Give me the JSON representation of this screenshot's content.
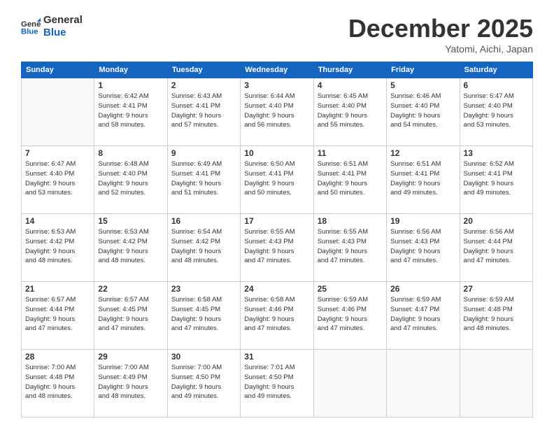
{
  "header": {
    "logo_general": "General",
    "logo_blue": "Blue",
    "month_title": "December 2025",
    "subtitle": "Yatomi, Aichi, Japan"
  },
  "weekdays": [
    "Sunday",
    "Monday",
    "Tuesday",
    "Wednesday",
    "Thursday",
    "Friday",
    "Saturday"
  ],
  "weeks": [
    [
      {
        "day": "",
        "info": ""
      },
      {
        "day": "1",
        "info": "Sunrise: 6:42 AM\nSunset: 4:41 PM\nDaylight: 9 hours\nand 58 minutes."
      },
      {
        "day": "2",
        "info": "Sunrise: 6:43 AM\nSunset: 4:41 PM\nDaylight: 9 hours\nand 57 minutes."
      },
      {
        "day": "3",
        "info": "Sunrise: 6:44 AM\nSunset: 4:40 PM\nDaylight: 9 hours\nand 56 minutes."
      },
      {
        "day": "4",
        "info": "Sunrise: 6:45 AM\nSunset: 4:40 PM\nDaylight: 9 hours\nand 55 minutes."
      },
      {
        "day": "5",
        "info": "Sunrise: 6:46 AM\nSunset: 4:40 PM\nDaylight: 9 hours\nand 54 minutes."
      },
      {
        "day": "6",
        "info": "Sunrise: 6:47 AM\nSunset: 4:40 PM\nDaylight: 9 hours\nand 53 minutes."
      }
    ],
    [
      {
        "day": "7",
        "info": "Sunrise: 6:47 AM\nSunset: 4:40 PM\nDaylight: 9 hours\nand 53 minutes."
      },
      {
        "day": "8",
        "info": "Sunrise: 6:48 AM\nSunset: 4:40 PM\nDaylight: 9 hours\nand 52 minutes."
      },
      {
        "day": "9",
        "info": "Sunrise: 6:49 AM\nSunset: 4:41 PM\nDaylight: 9 hours\nand 51 minutes."
      },
      {
        "day": "10",
        "info": "Sunrise: 6:50 AM\nSunset: 4:41 PM\nDaylight: 9 hours\nand 50 minutes."
      },
      {
        "day": "11",
        "info": "Sunrise: 6:51 AM\nSunset: 4:41 PM\nDaylight: 9 hours\nand 50 minutes."
      },
      {
        "day": "12",
        "info": "Sunrise: 6:51 AM\nSunset: 4:41 PM\nDaylight: 9 hours\nand 49 minutes."
      },
      {
        "day": "13",
        "info": "Sunrise: 6:52 AM\nSunset: 4:41 PM\nDaylight: 9 hours\nand 49 minutes."
      }
    ],
    [
      {
        "day": "14",
        "info": "Sunrise: 6:53 AM\nSunset: 4:42 PM\nDaylight: 9 hours\nand 48 minutes."
      },
      {
        "day": "15",
        "info": "Sunrise: 6:53 AM\nSunset: 4:42 PM\nDaylight: 9 hours\nand 48 minutes."
      },
      {
        "day": "16",
        "info": "Sunrise: 6:54 AM\nSunset: 4:42 PM\nDaylight: 9 hours\nand 48 minutes."
      },
      {
        "day": "17",
        "info": "Sunrise: 6:55 AM\nSunset: 4:43 PM\nDaylight: 9 hours\nand 47 minutes."
      },
      {
        "day": "18",
        "info": "Sunrise: 6:55 AM\nSunset: 4:43 PM\nDaylight: 9 hours\nand 47 minutes."
      },
      {
        "day": "19",
        "info": "Sunrise: 6:56 AM\nSunset: 4:43 PM\nDaylight: 9 hours\nand 47 minutes."
      },
      {
        "day": "20",
        "info": "Sunrise: 6:56 AM\nSunset: 4:44 PM\nDaylight: 9 hours\nand 47 minutes."
      }
    ],
    [
      {
        "day": "21",
        "info": "Sunrise: 6:57 AM\nSunset: 4:44 PM\nDaylight: 9 hours\nand 47 minutes."
      },
      {
        "day": "22",
        "info": "Sunrise: 6:57 AM\nSunset: 4:45 PM\nDaylight: 9 hours\nand 47 minutes."
      },
      {
        "day": "23",
        "info": "Sunrise: 6:58 AM\nSunset: 4:45 PM\nDaylight: 9 hours\nand 47 minutes."
      },
      {
        "day": "24",
        "info": "Sunrise: 6:58 AM\nSunset: 4:46 PM\nDaylight: 9 hours\nand 47 minutes."
      },
      {
        "day": "25",
        "info": "Sunrise: 6:59 AM\nSunset: 4:46 PM\nDaylight: 9 hours\nand 47 minutes."
      },
      {
        "day": "26",
        "info": "Sunrise: 6:59 AM\nSunset: 4:47 PM\nDaylight: 9 hours\nand 47 minutes."
      },
      {
        "day": "27",
        "info": "Sunrise: 6:59 AM\nSunset: 4:48 PM\nDaylight: 9 hours\nand 48 minutes."
      }
    ],
    [
      {
        "day": "28",
        "info": "Sunrise: 7:00 AM\nSunset: 4:48 PM\nDaylight: 9 hours\nand 48 minutes."
      },
      {
        "day": "29",
        "info": "Sunrise: 7:00 AM\nSunset: 4:49 PM\nDaylight: 9 hours\nand 48 minutes."
      },
      {
        "day": "30",
        "info": "Sunrise: 7:00 AM\nSunset: 4:50 PM\nDaylight: 9 hours\nand 49 minutes."
      },
      {
        "day": "31",
        "info": "Sunrise: 7:01 AM\nSunset: 4:50 PM\nDaylight: 9 hours\nand 49 minutes."
      },
      {
        "day": "",
        "info": ""
      },
      {
        "day": "",
        "info": ""
      },
      {
        "day": "",
        "info": ""
      }
    ]
  ]
}
